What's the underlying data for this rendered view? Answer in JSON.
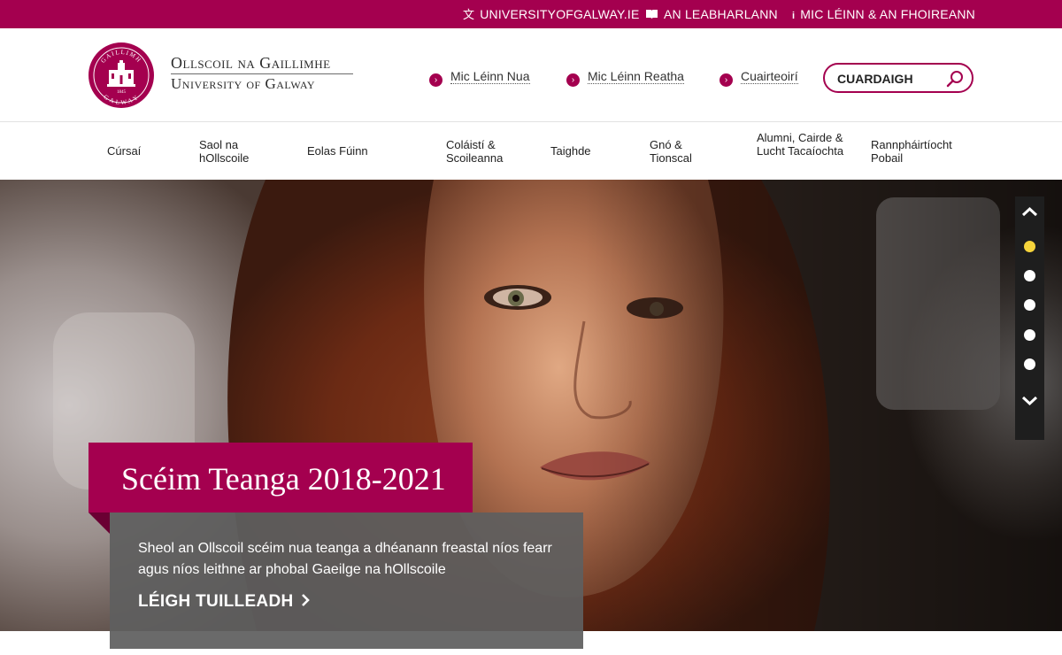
{
  "topbar": {
    "links": [
      {
        "label": "UNIVERSITYOFGALWAY.IE",
        "icon": "translate-icon"
      },
      {
        "label": "AN LEABHARLANN",
        "icon": "book-icon"
      },
      {
        "label": "MIC LÉINN & AN FHOIREANN",
        "icon": "info-icon"
      }
    ]
  },
  "header": {
    "logo": {
      "line1": "Ollscoil na Gaillimhe",
      "line2": "University of Galway",
      "seal_top": "GAILLIMH",
      "seal_bottom": "GALWAY",
      "seal_year": "1845"
    },
    "quick_links": [
      {
        "label": "Mic Léinn Nua"
      },
      {
        "label": "Mic Léinn Reatha"
      },
      {
        "label": "Cuairteoirí"
      }
    ],
    "search": {
      "placeholder": "CUARDAIGH",
      "icon": "search-icon"
    }
  },
  "nav": {
    "items": [
      {
        "label": "Cúrsaí"
      },
      {
        "label": "Saol na hOllscoile"
      },
      {
        "label": "Eolas Fúinn"
      },
      {
        "label": "Coláistí & Scoileanna"
      },
      {
        "label": "Taighde"
      },
      {
        "label": "Gnó & Tionscal"
      },
      {
        "label": "Alumni, Cairde & Lucht Tacaíochta"
      },
      {
        "label": "Rannpháirtíocht Pobail"
      }
    ]
  },
  "hero": {
    "title": "Scéim Teanga 2018-2021",
    "description": "Sheol an Ollscoil scéim nua teanga a dhéanann freastal níos fearr agus níos leithne ar phobal Gaeilge na hOllscoile",
    "cta": "LÉIGH TUILLEADH",
    "slides": {
      "count": 5,
      "active": 1
    }
  },
  "colors": {
    "brand": "#a4004f",
    "caption_bg": "#5f5f5f",
    "active_dot": "#f6d43b"
  }
}
